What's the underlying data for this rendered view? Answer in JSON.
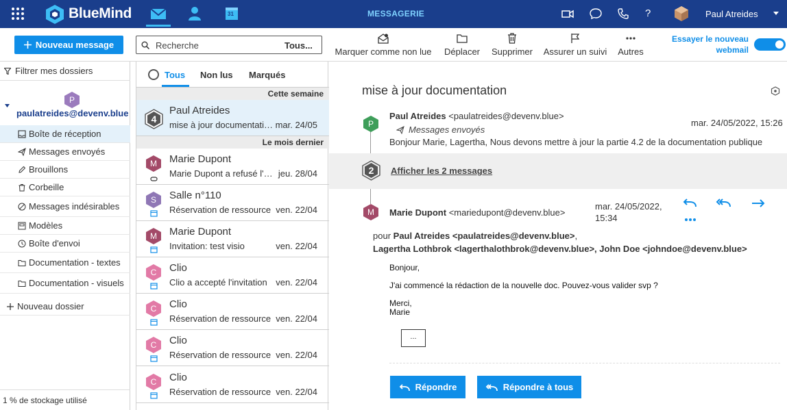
{
  "app": {
    "brand": "BlueMind",
    "title": "MESSAGERIE",
    "user_name": "Paul Atreides",
    "help": "?",
    "calendar_day": "31"
  },
  "toolbar": {
    "new_message": "Nouveau message",
    "search_placeholder": "Recherche",
    "search_scope": "Tous...",
    "mark_unread": "Marquer comme non lue",
    "move": "Déplacer",
    "delete": "Supprimer",
    "follow_up": "Assurer un suivi",
    "more": "Autres",
    "try_webmail": "Essayer le nouveau webmail"
  },
  "folders": {
    "filter": "Filtrer mes dossiers",
    "account_initial": "P",
    "account": "paulatreides@devenv.blue",
    "items": [
      {
        "label": "Boîte de réception"
      },
      {
        "label": "Messages envoyés"
      },
      {
        "label": "Brouillons"
      },
      {
        "label": "Corbeille"
      },
      {
        "label": "Messages indésirables"
      },
      {
        "label": "Modèles"
      },
      {
        "label": "Boîte d'envoi"
      },
      {
        "label": "Documentation - textes"
      },
      {
        "label": "Documentation - visuels"
      }
    ],
    "new_folder": "Nouveau dossier",
    "storage": "1 % de stockage utilisé"
  },
  "list": {
    "tabs": [
      "Tous",
      "Non lus",
      "Marqués"
    ],
    "groups": [
      "Cette semaine",
      "Le mois dernier"
    ],
    "messages": [
      {
        "initial": "4",
        "sender": "Paul Atreides",
        "preview": "mise à jour documentation",
        "date": "mar. 24/05"
      },
      {
        "initial": "M",
        "sender": "Marie Dupont",
        "preview": "Marie Dupont a refusé l'invitation",
        "date": "jeu. 28/04"
      },
      {
        "initial": "S",
        "sender": "Salle n°110",
        "preview": "Réservation de ressource",
        "date": "ven. 22/04"
      },
      {
        "initial": "M",
        "sender": "Marie Dupont",
        "preview": "Invitation: test visio",
        "date": "ven. 22/04"
      },
      {
        "initial": "C",
        "sender": "Clio",
        "preview": "Clio a accepté l'invitation",
        "date": "ven. 22/04"
      },
      {
        "initial": "C",
        "sender": "Clio",
        "preview": "Réservation de ressource",
        "date": "ven. 22/04"
      },
      {
        "initial": "C",
        "sender": "Clio",
        "preview": "Réservation de ressource",
        "date": "ven. 22/04"
      },
      {
        "initial": "C",
        "sender": "Clio",
        "preview": "Réservation de ressource",
        "date": "ven. 22/04"
      }
    ]
  },
  "reader": {
    "subject": "mise à jour documentation",
    "first": {
      "initial": "P",
      "name": "Paul Atreides",
      "email": "<paulatreides@devenv.blue>",
      "folder": "Messages envoyés",
      "date": "mar. 24/05/2022, 15:26",
      "snippet": "Bonjour Marie, Lagertha, Nous devons mettre à jour la partie 4.2 de la documentation publique"
    },
    "collapsed_count": "2",
    "show_messages": "Afficher les 2 messages",
    "last": {
      "initial": "M",
      "name": "Marie Dupont",
      "email": "<mariedupont@devenv.blue>",
      "date_line1": "mar. 24/05/2022,",
      "date_line2": "15:34",
      "to_prefix": "pour",
      "to": "Paul Atreides <paulatreides@devenv.blue>",
      "to_sep": ",",
      "cc": "Lagertha Lothbrok <lagerthalothbrok@devenv.blue>, John Doe <johndoe@devenv.blue>",
      "body": [
        "Bonjour,",
        "J'ai commencé la rédaction de la nouvelle doc. Pouvez-vous valider svp ?",
        "Merci,",
        "Marie"
      ],
      "quote": "...",
      "reply": "Répondre",
      "reply_all": "Répondre à tous"
    }
  },
  "colors": {
    "topbar": "#1a3e8c",
    "accent": "#0f8ee8",
    "avatar_purple": "#9b7bbd",
    "avatar_green": "#3e9e5a",
    "avatar_maroon": "#a34a68",
    "avatar_pink": "#e27aa6",
    "avatar_violet": "#8f77b5"
  }
}
